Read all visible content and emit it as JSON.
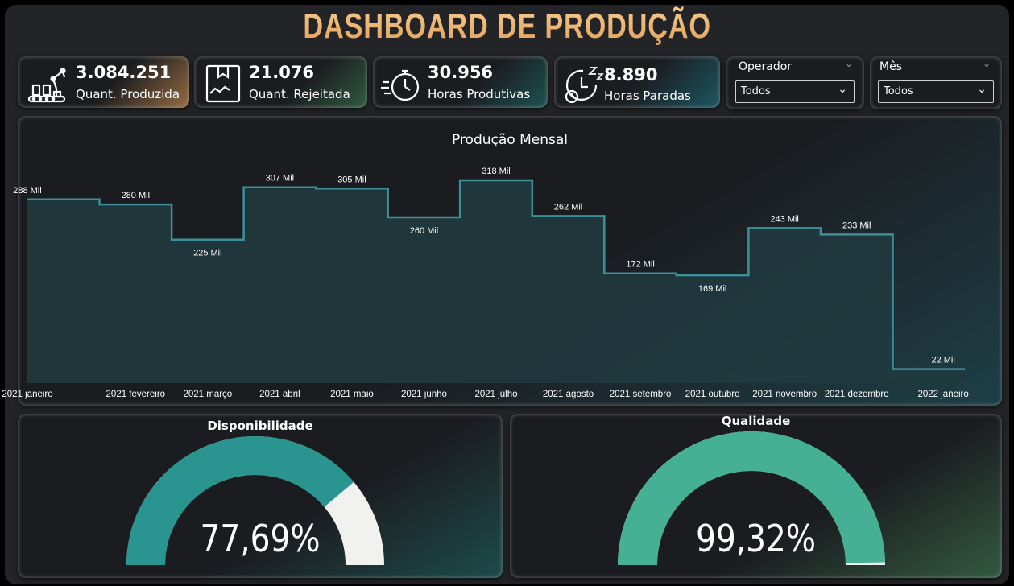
{
  "header": {
    "title": "DASHBOARD DE PRODUÇÃO"
  },
  "kpis": [
    {
      "value": "3.084.251",
      "label": "Quant. Produzida",
      "icon": "robot-arm-factory-icon",
      "accent": "#e9a35a"
    },
    {
      "value": "21.076",
      "label": "Quant. Rejeitada",
      "icon": "damaged-box-icon",
      "accent": "#3f8a5a"
    },
    {
      "value": "30.956",
      "label": "Horas Produtivas",
      "icon": "stopwatch-icon",
      "accent": "#1f6f6f"
    },
    {
      "value": "8.890",
      "label": "Horas Paradas",
      "icon": "sleeping-clock-icon",
      "accent": "#1f6f7a"
    }
  ],
  "filters": [
    {
      "label": "Operador",
      "selected": "Todos"
    },
    {
      "label": "Mês",
      "selected": "Todos"
    }
  ],
  "colors": {
    "line": "#3f8f9a",
    "area": "#203b40",
    "gauge_disp": "#2a9590",
    "gauge_qual": "#45b094",
    "gauge_rest": "#f1f1ef"
  },
  "chart_data": {
    "type": "area",
    "title": "Produção Mensal",
    "categories": [
      "2021 janeiro",
      "2021 fevereiro",
      "2021 março",
      "2021 abril",
      "2021 maio",
      "2021 junho",
      "2021 julho",
      "2021 agosto",
      "2021 setembro",
      "2021 outubro",
      "2021 novembro",
      "2021 dezembro",
      "2022 janeiro"
    ],
    "values": [
      288,
      280,
      225,
      307,
      305,
      260,
      318,
      262,
      172,
      169,
      243,
      233,
      22
    ],
    "data_labels": [
      "288 Mil",
      "280 Mil",
      "225 Mil",
      "307 Mil",
      "305 Mil",
      "260 Mil",
      "318 Mil",
      "262 Mil",
      "172 Mil",
      "169 Mil",
      "243 Mil",
      "233 Mil",
      "22 Mil"
    ],
    "unit": "Mil",
    "step": true,
    "ylim": [
      0,
      318
    ]
  },
  "gauges": [
    {
      "title": "Disponibilidade",
      "value": 77.69,
      "display": "77,69%"
    },
    {
      "title": "Qualidade",
      "value": 99.32,
      "display": "99,32%"
    }
  ]
}
